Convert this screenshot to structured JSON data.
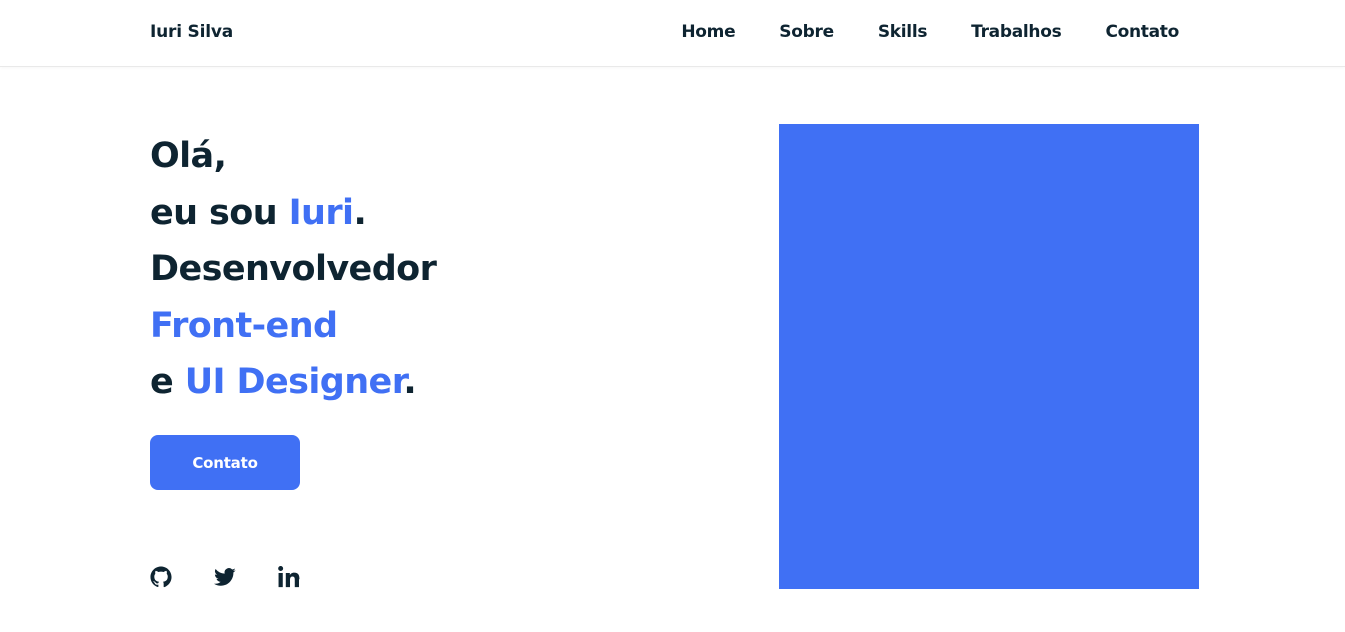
{
  "header": {
    "logo": "Iuri Silva",
    "nav": [
      {
        "label": "Home"
      },
      {
        "label": "Sobre"
      },
      {
        "label": "Skills"
      },
      {
        "label": "Trabalhos"
      },
      {
        "label": "Contato"
      }
    ]
  },
  "hero": {
    "line1": "Olá,",
    "line2_prefix": "eu sou ",
    "line2_name": "Iuri",
    "line2_suffix": ".",
    "line3": "Desenvolvedor",
    "line4": "Front-end",
    "line5_prefix": "e ",
    "line5_accent": "UI Designer",
    "line5_suffix": ".",
    "button_label": "Contato"
  },
  "social": [
    {
      "icon": "github-icon"
    },
    {
      "icon": "twitter-icon"
    },
    {
      "icon": "linkedin-icon"
    }
  ],
  "colors": {
    "accent": "#4070f4",
    "text": "#0e2431",
    "background": "#ffffff"
  }
}
